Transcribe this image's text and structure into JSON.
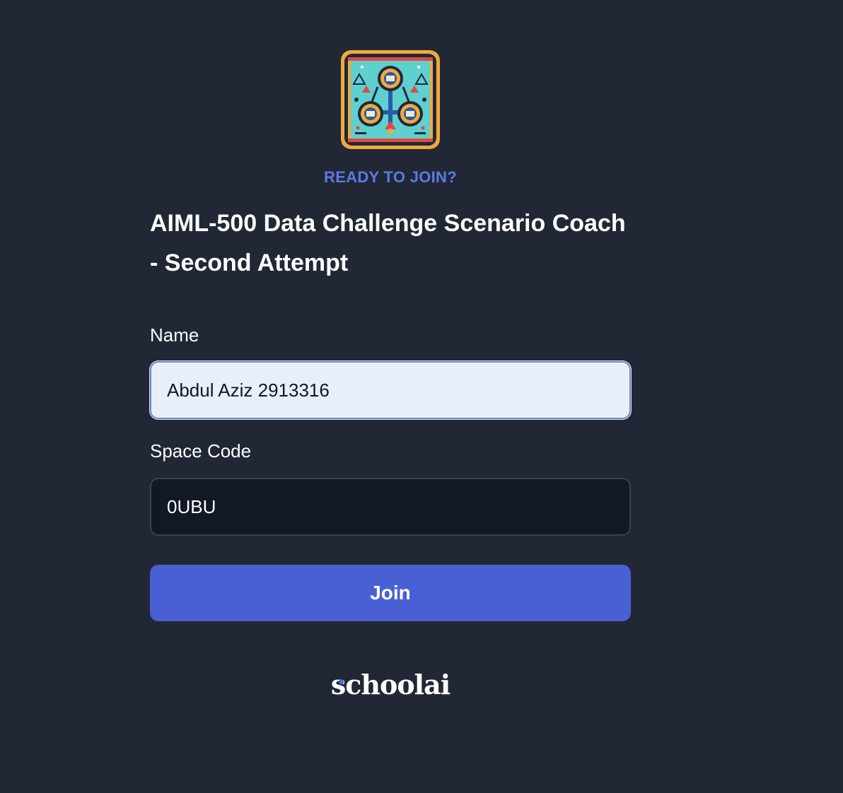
{
  "space": {
    "kicker": "READY TO JOIN?",
    "title": "AIML-500 Data Challenge Scenario Coach - Second Attempt",
    "icon": "space-artwork-icon"
  },
  "form": {
    "name_label": "Name",
    "name_value": "Abdul Aziz 2913316",
    "code_label": "Space Code",
    "code_value": "0UBU",
    "join_label": "Join"
  },
  "brand": {
    "wordmark": "schoolai"
  },
  "colors": {
    "background": "#212735",
    "accent": "#4860d3",
    "kicker": "#5a7be3",
    "name_field_bg": "#e8effb",
    "code_field_bg": "#121826"
  }
}
